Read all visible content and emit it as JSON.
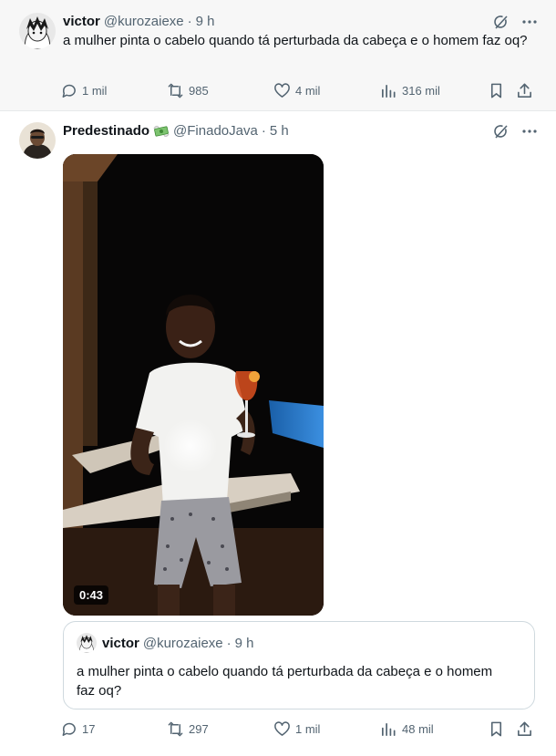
{
  "tweet1": {
    "name": "victor",
    "handle": "@kurozaiexe",
    "time": "9 h",
    "text": "a mulher pinta o cabelo quando tá perturbada da cabeça e o homem faz oq?",
    "replies": "1 mil",
    "reposts": "985",
    "likes": "4 mil",
    "views": "316 mil"
  },
  "tweet2": {
    "name": "Predestinado",
    "emoji": "money-with-wings-icon",
    "handle": "@FinadoJava",
    "time": "5 h",
    "video_duration": "0:43",
    "replies": "17",
    "reposts": "297",
    "likes": "1 mil",
    "views": "48 mil"
  },
  "quote": {
    "name": "victor",
    "handle": "@kurozaiexe",
    "time": "9 h",
    "text": "a mulher pinta o cabelo quando tá perturbada da cabeça e o homem faz oq?"
  },
  "separator": "·",
  "colors": {
    "text_primary": "#0f1419",
    "text_muted": "#536471",
    "border": "#cfd9de",
    "highlight_bg": "#f7f7f7"
  }
}
